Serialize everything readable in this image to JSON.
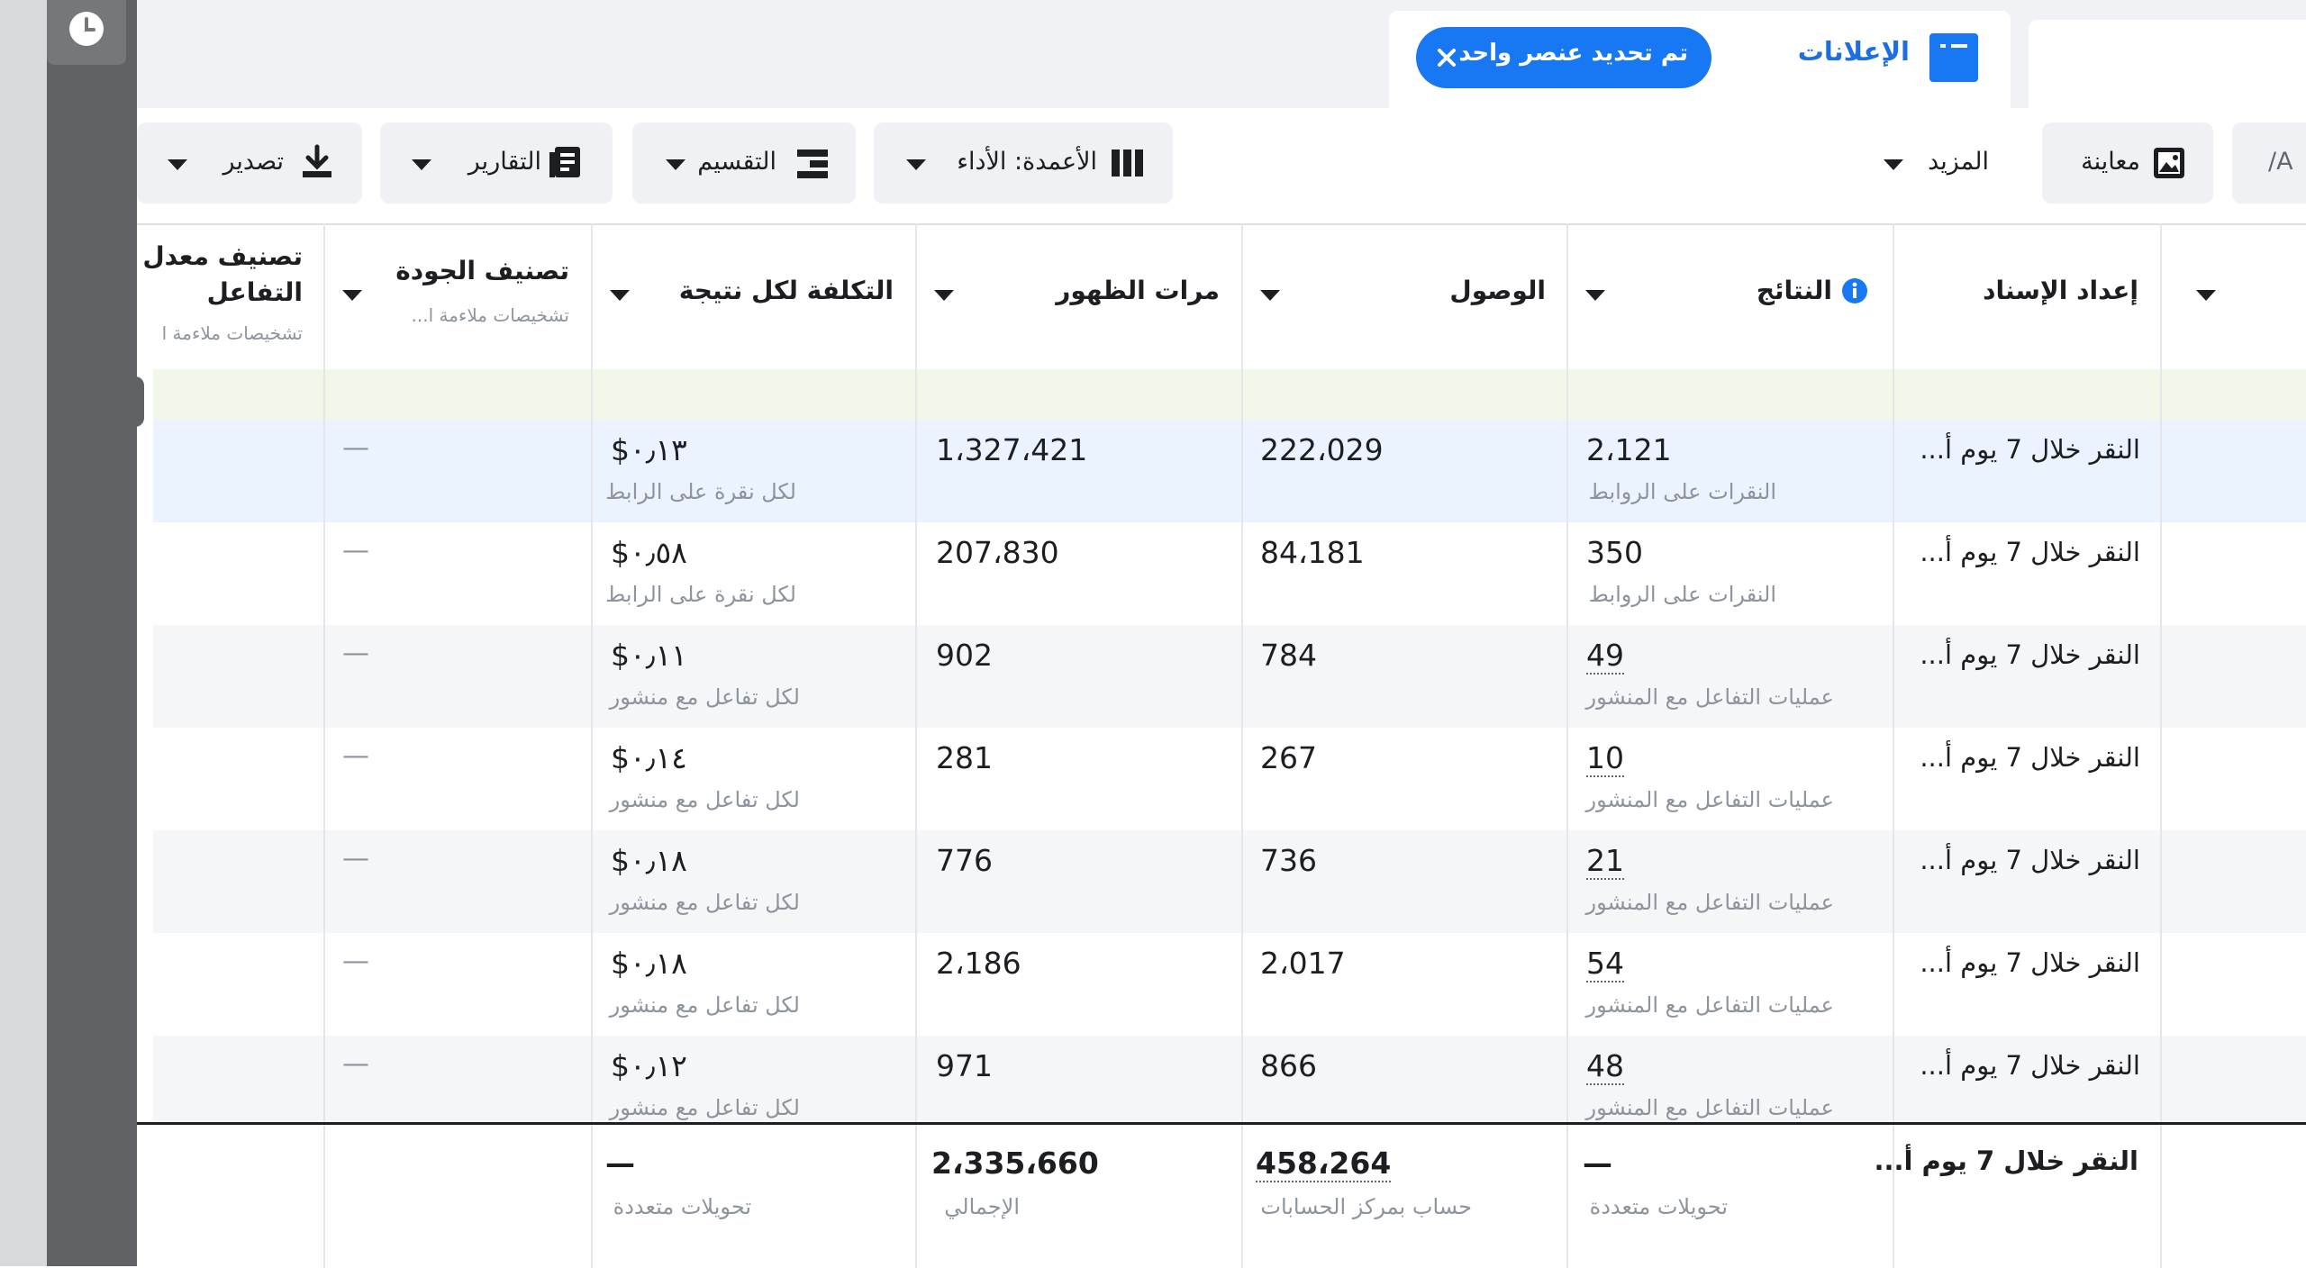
{
  "sidebar": {
    "clock_icon": "clock-icon"
  },
  "tabs": {
    "ads_label": "الإعلانات",
    "selection_text": "تم تحديد عنصر واحد",
    "right_tab_text": "A/"
  },
  "toolbar": {
    "preview_label": "معاينة",
    "more_label": "المزيد",
    "columns_label": "الأعمدة: الأداء",
    "breakdown_label": "التقسيم",
    "reports_label": "التقارير",
    "export_label": "تصدير"
  },
  "columns": {
    "attribution": "إعداد الإسناد",
    "results": "النتائج",
    "reach": "الوصول",
    "impressions": "مرات الظهور",
    "cost_per_result": "التكلفة لكل نتيجة",
    "quality_ranking": "تصنيف الجودة",
    "quality_sub": "تشخيصات ملاءمة ا...",
    "engagement_ranking_1": "تصنيف معدل",
    "engagement_ranking_2": "التفاعل",
    "engagement_sub": "تشخيصات ملاءمة ا"
  },
  "rows": [
    {
      "attribution": "النقر خلال 7 يوم أ...",
      "results": "2،121",
      "results_sub": "النقرات على الروابط",
      "reach": "222،029",
      "impressions": "1،327،421",
      "cost": "٠٫١٣$",
      "cost_sub": "لكل نقرة على الرابط",
      "quality": "—"
    },
    {
      "attribution": "النقر خلال 7 يوم أ...",
      "results": "350",
      "results_sub": "النقرات على الروابط",
      "reach": "84،181",
      "impressions": "207،830",
      "cost": "٠٫٥٨$",
      "cost_sub": "لكل نقرة على الرابط",
      "quality": "—"
    },
    {
      "attribution": "النقر خلال 7 يوم أ...",
      "results": "49",
      "results_sub": "عمليات التفاعل مع المنشور",
      "reach": "784",
      "impressions": "902",
      "cost": "٠٫١١$",
      "cost_sub": "لكل تفاعل مع منشور",
      "quality": "—"
    },
    {
      "attribution": "النقر خلال 7 يوم أ...",
      "results": "10",
      "results_sub": "عمليات التفاعل مع المنشور",
      "reach": "267",
      "impressions": "281",
      "cost": "٠٫١٤$",
      "cost_sub": "لكل تفاعل مع منشور",
      "quality": "—"
    },
    {
      "attribution": "النقر خلال 7 يوم أ...",
      "results": "21",
      "results_sub": "عمليات التفاعل مع المنشور",
      "reach": "736",
      "impressions": "776",
      "cost": "٠٫١٨$",
      "cost_sub": "لكل تفاعل مع منشور",
      "quality": "—"
    },
    {
      "attribution": "النقر خلال 7 يوم أ...",
      "results": "54",
      "results_sub": "عمليات التفاعل مع المنشور",
      "reach": "2،017",
      "impressions": "2،186",
      "cost": "٠٫١٨$",
      "cost_sub": "لكل تفاعل مع منشور",
      "quality": "—"
    },
    {
      "attribution": "النقر خلال 7 يوم أ...",
      "results": "48",
      "results_sub": "عمليات التفاعل مع المنشور",
      "reach": "866",
      "impressions": "971",
      "cost": "٠٫١٢$",
      "cost_sub": "لكل تفاعل مع منشور",
      "quality": "—"
    }
  ],
  "totals": {
    "attribution": "النقر خلال 7 يوم أ...",
    "results": "—",
    "results_sub": "تحويلات متعددة",
    "reach": "458،264",
    "reach_sub": "حساب بمركز الحسابات",
    "impressions": "2،335،660",
    "impressions_sub": "الإجمالي",
    "cost": "—",
    "cost_sub": "تحويلات متعددة"
  },
  "colors": {
    "accent": "#1877f2",
    "selected_row": "#eaf3ff",
    "highlight_row": "#f1f8e9"
  }
}
